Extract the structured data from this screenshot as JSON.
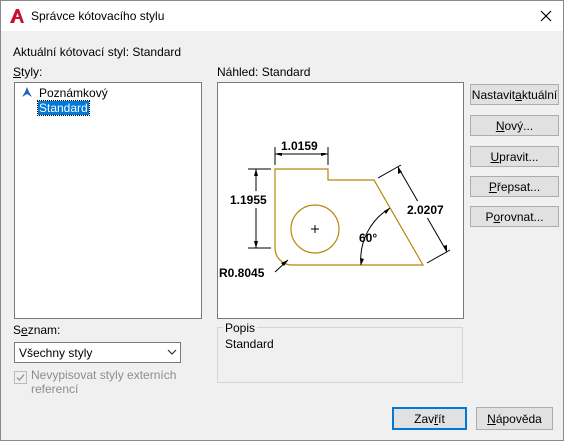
{
  "window": {
    "title": "Správce kótovacího stylu"
  },
  "current_style": {
    "label": "Aktuální kótovací styl: Standard"
  },
  "styles": {
    "label_prefix": "S",
    "label_rest": "tyly:",
    "items": [
      {
        "label": "Poznámkový",
        "icon": "annotative-icon"
      },
      {
        "label": "Standard",
        "selected": true
      }
    ]
  },
  "preview": {
    "label": "Náhled: Standard",
    "dims": {
      "top": "1.0159",
      "left": "1.1955",
      "right": "2.0207",
      "angle": "60°",
      "radius": "R0.8045"
    }
  },
  "buttons": {
    "set_current": {
      "pre": "Nastavit ",
      "u": "a",
      "post": "ktuální"
    },
    "new": {
      "pre": "",
      "u": "N",
      "post": "ový..."
    },
    "modify": {
      "pre": "",
      "u": "U",
      "post": "pravit..."
    },
    "override": {
      "pre": "",
      "u": "P",
      "post": "řepsat..."
    },
    "compare": {
      "pre": "P",
      "u": "o",
      "post": "rovnat..."
    },
    "close": {
      "pre": "Zav",
      "u": "ř",
      "post": "ít"
    },
    "help": {
      "pre": "",
      "u": "N",
      "post": "ápověda"
    }
  },
  "list_filter": {
    "label_pre": "S",
    "label_u": "e",
    "label_post": "znam:",
    "value": "Všechny styly"
  },
  "xref_checkbox": {
    "line1": "Nevypisovat styly externích",
    "line2": "referencí",
    "checked": true
  },
  "description": {
    "label": "Popis",
    "value": "Standard"
  },
  "colors": {
    "accent": "#0078d7",
    "geometry": "#b8860b",
    "app_icon": "#c8102e"
  }
}
